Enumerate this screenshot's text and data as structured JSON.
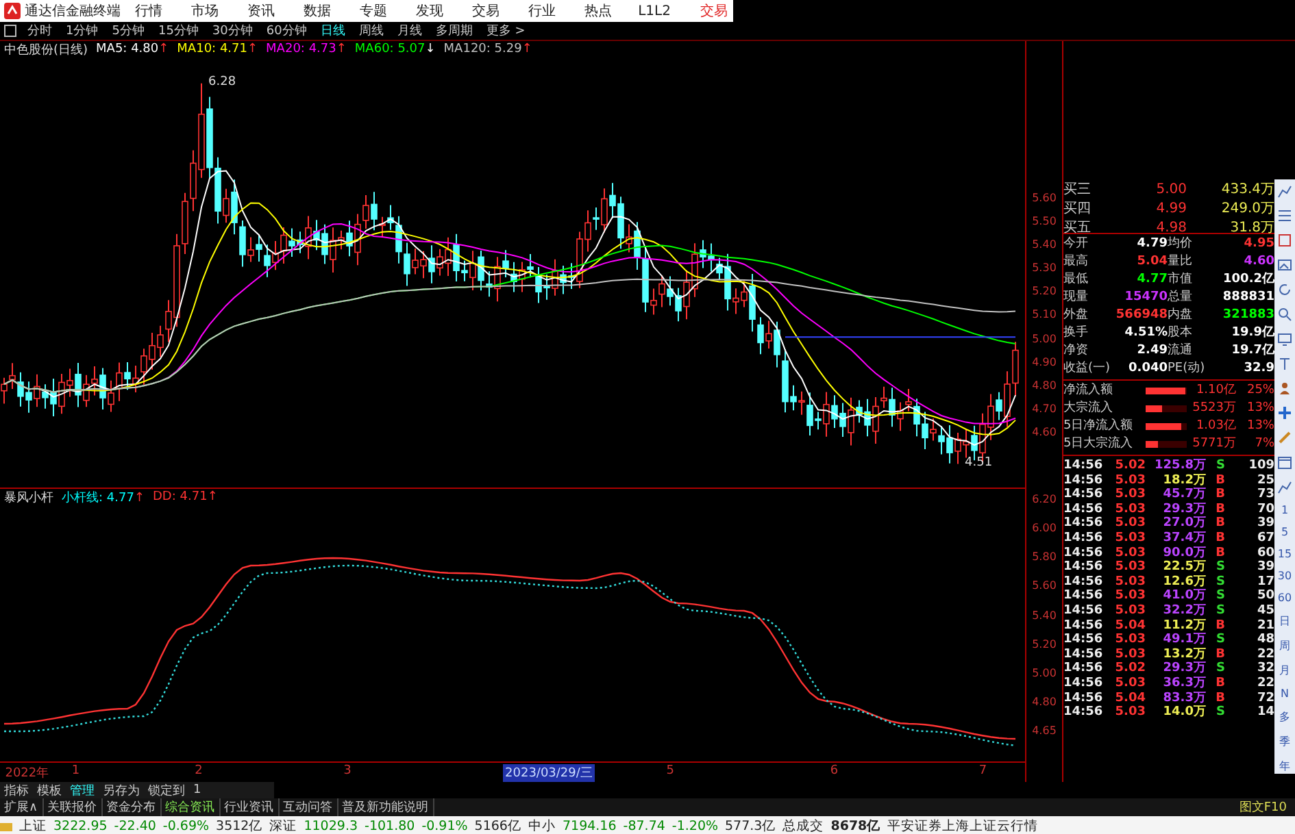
{
  "app": {
    "title": "通达信金融终端",
    "menu": [
      "行情",
      "市场",
      "资讯",
      "数据",
      "专题",
      "发现",
      "交易",
      "行业",
      "热点",
      "L1L2"
    ],
    "trade_button": "交易"
  },
  "periods": [
    {
      "label": "分时",
      "selected": false
    },
    {
      "label": "1分钟",
      "selected": false
    },
    {
      "label": "5分钟",
      "selected": false
    },
    {
      "label": "15分钟",
      "selected": false
    },
    {
      "label": "30分钟",
      "selected": false
    },
    {
      "label": "60分钟",
      "selected": false
    },
    {
      "label": "日线",
      "selected": true
    },
    {
      "label": "周线",
      "selected": false
    },
    {
      "label": "月线",
      "selected": false
    },
    {
      "label": "多周期",
      "selected": false
    },
    {
      "label": "更多 >",
      "selected": false
    }
  ],
  "stock": {
    "name": "中色股份(日线)",
    "ma": [
      {
        "label": "MA5: ",
        "value": "4.80",
        "arrow": "↑",
        "falling": false,
        "color": "#ffffff"
      },
      {
        "label": "MA10: ",
        "value": "4.71",
        "arrow": "↑",
        "falling": false,
        "color": "#ffff00"
      },
      {
        "label": "MA20: ",
        "value": "4.73",
        "arrow": "↑",
        "falling": false,
        "color": "#ff00ff"
      },
      {
        "label": "MA60: ",
        "value": "5.07",
        "arrow": "↓",
        "falling": true,
        "color": "#00ff00"
      },
      {
        "label": "MA120: ",
        "value": "5.29",
        "arrow": "↑",
        "falling": false,
        "color": "#c0c0c0"
      }
    ]
  },
  "price_marks": {
    "high": "6.28",
    "low": "4.51"
  },
  "upper_axis": [
    "5.60",
    "5.50",
    "5.40",
    "5.30",
    "5.20",
    "5.10",
    "5.00",
    "4.90",
    "4.80",
    "4.70",
    "4.60"
  ],
  "indicator": {
    "name": "暴风小杆",
    "lines": [
      {
        "label": "小杆线: ",
        "value": "4.77",
        "arrow": "↑",
        "falling": false,
        "color": "#00ffff"
      },
      {
        "label": "DD: ",
        "value": "4.71",
        "arrow": "↑",
        "falling": false,
        "color": "#ff3333"
      }
    ]
  },
  "lower_axis": [
    "6.20",
    "6.00",
    "5.80",
    "5.60",
    "5.40",
    "5.20",
    "5.00",
    "4.80",
    "4.65"
  ],
  "date_axis": [
    {
      "label": "2022年",
      "selected": false
    },
    {
      "label": "1",
      "selected": false
    },
    {
      "label": "2",
      "selected": false
    },
    {
      "label": "3",
      "selected": false
    },
    {
      "label": "2023/03/29/三",
      "selected": true
    },
    {
      "label": "5",
      "selected": false
    },
    {
      "label": "6",
      "selected": false
    },
    {
      "label": "7",
      "selected": false
    }
  ],
  "order_book": [
    {
      "label": "买三",
      "price": "5.00",
      "volume": "433.4万"
    },
    {
      "label": "买四",
      "price": "4.99",
      "volume": "249.0万"
    },
    {
      "label": "买五",
      "price": "4.98",
      "volume": "31.8万"
    }
  ],
  "quote": [
    {
      "label": "今开",
      "value": "4.79",
      "color": "#ffffff"
    },
    {
      "label": "均价",
      "value": "4.95",
      "color": "#ff3333"
    },
    {
      "label": "最高",
      "value": "5.04",
      "color": "#ff3333"
    },
    {
      "label": "量比",
      "value": "4.60",
      "color": "#cc33ff"
    },
    {
      "label": "最低",
      "value": "4.77",
      "color": "#00ff00"
    },
    {
      "label": "市值",
      "value": "100.2亿",
      "color": "#ffffff"
    },
    {
      "label": "现量",
      "value": "15470",
      "color": "#cc33ff"
    },
    {
      "label": "总量",
      "value": "888831",
      "color": "#ffffff"
    },
    {
      "label": "外盘",
      "value": "566948",
      "color": "#ff3333"
    },
    {
      "label": "内盘",
      "value": "321883",
      "color": "#00ff00"
    },
    {
      "label": "换手",
      "value": "4.51%",
      "color": "#ffffff"
    },
    {
      "label": "股本",
      "value": "19.9亿",
      "color": "#ffffff"
    },
    {
      "label": "净资",
      "value": "2.49",
      "color": "#ffffff"
    },
    {
      "label": "流通",
      "value": "19.7亿",
      "color": "#ffffff"
    },
    {
      "label": "收益(一)",
      "value": "0.040",
      "color": "#ffffff"
    },
    {
      "label": "PE(动)",
      "value": "32.9",
      "color": "#ffffff"
    }
  ],
  "fund_flow": [
    {
      "label": "净流入额",
      "level": 0.95,
      "amount": "1.10亿",
      "share": "25%"
    },
    {
      "label": "大宗流入",
      "level": 0.4,
      "amount": "5523万",
      "share": "13%"
    },
    {
      "label": "5日净流入额",
      "level": 0.85,
      "amount": "1.03亿",
      "share": "13%"
    },
    {
      "label": "5日大宗流入",
      "level": 0.3,
      "amount": "5771万",
      "share": "7%"
    }
  ],
  "trades": [
    {
      "time": "14:56",
      "price": "5.02",
      "volume": "125.8万",
      "big": true,
      "side": "S",
      "count": "109"
    },
    {
      "time": "14:56",
      "price": "5.03",
      "volume": "18.2万",
      "big": false,
      "side": "B",
      "count": "25"
    },
    {
      "time": "14:56",
      "price": "5.03",
      "volume": "45.7万",
      "big": true,
      "side": "B",
      "count": "73"
    },
    {
      "time": "14:56",
      "price": "5.03",
      "volume": "29.3万",
      "big": true,
      "side": "B",
      "count": "70"
    },
    {
      "time": "14:56",
      "price": "5.03",
      "volume": "27.0万",
      "big": true,
      "side": "B",
      "count": "39"
    },
    {
      "time": "14:56",
      "price": "5.03",
      "volume": "37.4万",
      "big": true,
      "side": "B",
      "count": "67"
    },
    {
      "time": "14:56",
      "price": "5.03",
      "volume": "90.0万",
      "big": true,
      "side": "B",
      "count": "60"
    },
    {
      "time": "14:56",
      "price": "5.03",
      "volume": "22.5万",
      "big": false,
      "side": "S",
      "count": "39"
    },
    {
      "time": "14:56",
      "price": "5.03",
      "volume": "12.6万",
      "big": false,
      "side": "S",
      "count": "17"
    },
    {
      "time": "14:56",
      "price": "5.03",
      "volume": "41.0万",
      "big": true,
      "side": "S",
      "count": "50"
    },
    {
      "time": "14:56",
      "price": "5.03",
      "volume": "32.2万",
      "big": true,
      "side": "S",
      "count": "45"
    },
    {
      "time": "14:56",
      "price": "5.04",
      "volume": "11.2万",
      "big": false,
      "side": "B",
      "count": "21"
    },
    {
      "time": "14:56",
      "price": "5.03",
      "volume": "49.1万",
      "big": true,
      "side": "S",
      "count": "48"
    },
    {
      "time": "14:56",
      "price": "5.03",
      "volume": "13.2万",
      "big": false,
      "side": "B",
      "count": "22"
    },
    {
      "time": "14:56",
      "price": "5.02",
      "volume": "29.3万",
      "big": true,
      "side": "S",
      "count": "32"
    },
    {
      "time": "14:56",
      "price": "5.03",
      "volume": "36.3万",
      "big": true,
      "side": "B",
      "count": "22"
    },
    {
      "time": "14:56",
      "price": "5.04",
      "volume": "83.3万",
      "big": true,
      "side": "B",
      "count": "72"
    },
    {
      "time": "14:56",
      "price": "5.03",
      "volume": "14.0万",
      "big": false,
      "side": "S",
      "count": "14"
    }
  ],
  "side_toolbar": [
    "1",
    "5",
    "15",
    "30",
    "60",
    "日",
    "周",
    "月",
    "N",
    "多",
    "季",
    "年"
  ],
  "tools": [
    {
      "label": "指标",
      "selected": false
    },
    {
      "label": "模板",
      "selected": false
    },
    {
      "label": "管理",
      "selected": true
    },
    {
      "label": "另存为",
      "selected": false
    },
    {
      "label": "锁定到",
      "selected": false
    },
    {
      "label": "1",
      "selected": false
    }
  ],
  "info_tabs": [
    {
      "label": "扩展∧",
      "selected": false
    },
    {
      "label": "关联报价",
      "selected": false
    },
    {
      "label": "资金分布",
      "selected": false
    },
    {
      "label": "综合资讯",
      "selected": true
    },
    {
      "label": "行业资讯",
      "selected": false
    },
    {
      "label": "互动问答",
      "selected": false
    },
    {
      "label": "普及新功能说明",
      "selected": false
    }
  ],
  "f10_button": "图文F10",
  "status": {
    "indices": [
      {
        "name": "上证",
        "value": "3222.95",
        "change": "-22.40",
        "percent": "-0.69%",
        "turnover": "3512亿",
        "falling": true
      },
      {
        "name": "深证",
        "value": "11029.3",
        "change": "-101.80",
        "percent": "-0.91%",
        "turnover": "5166亿",
        "falling": true
      },
      {
        "name": "中小",
        "value": "7194.16",
        "change": "-87.74",
        "percent": "-1.20%",
        "turnover": "577.3亿",
        "falling": true
      }
    ],
    "total_label": "总成交",
    "total_value": "8678亿",
    "feed": "平安证券上海上证云行情"
  }
}
